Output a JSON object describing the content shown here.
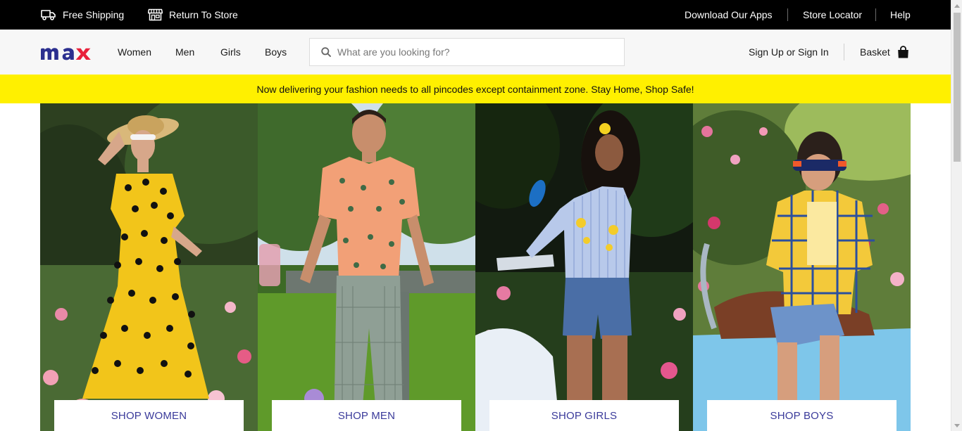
{
  "topbar": {
    "free_shipping": "Free Shipping",
    "return_to_store": "Return To Store",
    "download_apps": "Download Our Apps",
    "store_locator": "Store Locator",
    "help": "Help"
  },
  "header": {
    "logo_text": "max",
    "nav": {
      "women": "Women",
      "men": "Men",
      "girls": "Girls",
      "boys": "Boys"
    },
    "search_placeholder": "What are you looking for?",
    "account_label": "Sign Up or Sign In",
    "basket_label": "Basket"
  },
  "promo": {
    "message": "Now delivering your fashion needs to all pincodes except containment zone. Stay Home, Shop Safe!"
  },
  "tiles": {
    "women": "SHOP WOMEN",
    "men": "SHOP MEN",
    "girls": "SHOP GIRLS",
    "boys": "SHOP BOYS"
  },
  "icons": {
    "shipping": "truck-icon",
    "store": "storefront-icon",
    "search": "search-icon",
    "basket": "shopping-bag-icon"
  },
  "colors": {
    "brand_navy": "#2b2f8f",
    "brand_red": "#e8213a",
    "promo_yellow": "#fff000",
    "cta_text": "#3a3a9a",
    "topbar": "#000000"
  }
}
